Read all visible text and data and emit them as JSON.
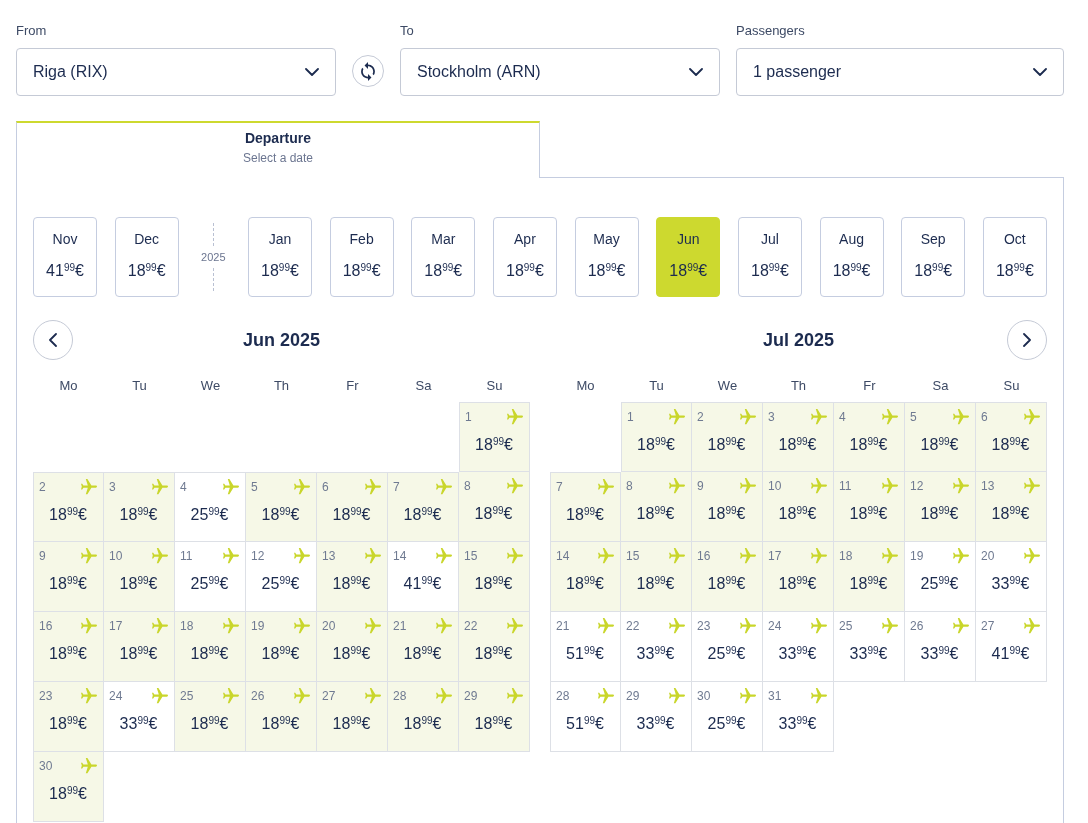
{
  "fields": [
    {
      "label": "From",
      "value": "Riga (RIX)"
    },
    {
      "label": "To",
      "value": "Stockholm (ARN)"
    },
    {
      "label": "Passengers",
      "value": "1 passenger"
    }
  ],
  "tabs": [
    {
      "title": "Departure",
      "subtitle": "Select a date",
      "selected": true
    }
  ],
  "month_strip": [
    {
      "kind": "month",
      "label": "Nov",
      "price": "41$^{99}$€",
      "selected": false
    },
    {
      "kind": "month",
      "label": "Dec",
      "price": "18$^{99}$€",
      "selected": false
    },
    {
      "kind": "year",
      "label": "2025"
    },
    {
      "kind": "month",
      "label": "Jan",
      "price": "18$^{99}$€",
      "selected": false
    },
    {
      "kind": "month",
      "label": "Feb",
      "price": "18$^{99}$€",
      "selected": false
    },
    {
      "kind": "month",
      "label": "Mar",
      "price": "18$^{99}$€",
      "selected": false
    },
    {
      "kind": "month",
      "label": "Apr",
      "price": "18$^{99}$€",
      "selected": false
    },
    {
      "kind": "month",
      "label": "May",
      "price": "18$^{99}$€",
      "selected": false
    },
    {
      "kind": "month",
      "label": "Jun",
      "price": "18$^{99}$€",
      "selected": true
    },
    {
      "kind": "month",
      "label": "Jul",
      "price": "18$^{99}$€",
      "selected": false
    },
    {
      "kind": "month",
      "label": "Aug",
      "price": "18$^{99}$€",
      "selected": false
    },
    {
      "kind": "month",
      "label": "Sep",
      "price": "18$^{99}$€",
      "selected": false
    },
    {
      "kind": "month",
      "label": "Oct",
      "price": "18$^{99}$€",
      "selected": false
    }
  ],
  "calendars": [
    {
      "title": "Jun 2025",
      "weekdays": [
        "Mo",
        "Tu",
        "We",
        "Th",
        "Fr",
        "Sa",
        "Su"
      ],
      "weeks": [
        [
          {
            "day": "1",
            "price": "18$^{99}$€",
            "low_fare": true
          }
        ],
        [
          {
            "day": "2",
            "price": "18$^{99}$€",
            "low_fare": true
          },
          {
            "day": "3",
            "price": "18$^{99}$€",
            "low_fare": true
          },
          {
            "day": "4",
            "price": "25$^{99}$€",
            "low_fare": false
          },
          {
            "day": "5",
            "price": "18$^{99}$€",
            "low_fare": true
          },
          {
            "day": "6",
            "price": "18$^{99}$€",
            "low_fare": true
          },
          {
            "day": "7",
            "price": "18$^{99}$€",
            "low_fare": true
          },
          {
            "day": "8",
            "price": "18$^{99}$€",
            "low_fare": true
          }
        ],
        [
          {
            "day": "9",
            "price": "18$^{99}$€",
            "low_fare": true
          },
          {
            "day": "10",
            "price": "18$^{99}$€",
            "low_fare": true
          },
          {
            "day": "11",
            "price": "25$^{99}$€",
            "low_fare": false
          },
          {
            "day": "12",
            "price": "25$^{99}$€",
            "low_fare": false
          },
          {
            "day": "13",
            "price": "18$^{99}$€",
            "low_fare": true
          },
          {
            "day": "14",
            "price": "41$^{99}$€",
            "low_fare": false
          },
          {
            "day": "15",
            "price": "18$^{99}$€",
            "low_fare": true
          }
        ],
        [
          {
            "day": "16",
            "price": "18$^{99}$€",
            "low_fare": true
          },
          {
            "day": "17",
            "price": "18$^{99}$€",
            "low_fare": true
          },
          {
            "day": "18",
            "price": "18$^{99}$€",
            "low_fare": true
          },
          {
            "day": "19",
            "price": "18$^{99}$€",
            "low_fare": true
          },
          {
            "day": "20",
            "price": "18$^{99}$€",
            "low_fare": true
          },
          {
            "day": "21",
            "price": "18$^{99}$€",
            "low_fare": true
          },
          {
            "day": "22",
            "price": "18$^{99}$€",
            "low_fare": true
          }
        ],
        [
          {
            "day": "23",
            "price": "18$^{99}$€",
            "low_fare": true
          },
          {
            "day": "24",
            "price": "33$^{99}$€",
            "low_fare": false
          },
          {
            "day": "25",
            "price": "18$^{99}$€",
            "low_fare": true
          },
          {
            "day": "26",
            "price": "18$^{99}$€",
            "low_fare": true
          },
          {
            "day": "27",
            "price": "18$^{99}$€",
            "low_fare": true
          },
          {
            "day": "28",
            "price": "18$^{99}$€",
            "low_fare": true
          },
          {
            "day": "29",
            "price": "18$^{99}$€",
            "low_fare": true
          }
        ],
        [
          {
            "day": "30",
            "price": "18$^{99}$€",
            "low_fare": true
          }
        ]
      ]
    },
    {
      "title": "Jul 2025",
      "weekdays": [
        "Mo",
        "Tu",
        "We",
        "Th",
        "Fr",
        "Sa",
        "Su"
      ],
      "weeks": [
        [
          {
            "day": "1",
            "price": "18$^{99}$€",
            "low_fare": true
          },
          {
            "day": "2",
            "price": "18$^{99}$€",
            "low_fare": true
          },
          {
            "day": "3",
            "price": "18$^{99}$€",
            "low_fare": true
          },
          {
            "day": "4",
            "price": "18$^{99}$€",
            "low_fare": true
          },
          {
            "day": "5",
            "price": "18$^{99}$€",
            "low_fare": true
          },
          {
            "day": "6",
            "price": "18$^{99}$€",
            "low_fare": true
          }
        ],
        [
          {
            "day": "7",
            "price": "18$^{99}$€",
            "low_fare": true
          },
          {
            "day": "8",
            "price": "18$^{99}$€",
            "low_fare": true
          },
          {
            "day": "9",
            "price": "18$^{99}$€",
            "low_fare": true
          },
          {
            "day": "10",
            "price": "18$^{99}$€",
            "low_fare": true
          },
          {
            "day": "11",
            "price": "18$^{99}$€",
            "low_fare": true
          },
          {
            "day": "12",
            "price": "18$^{99}$€",
            "low_fare": true
          },
          {
            "day": "13",
            "price": "18$^{99}$€",
            "low_fare": true
          }
        ],
        [
          {
            "day": "14",
            "price": "18$^{99}$€",
            "low_fare": true
          },
          {
            "day": "15",
            "price": "18$^{99}$€",
            "low_fare": true
          },
          {
            "day": "16",
            "price": "18$^{99}$€",
            "low_fare": true
          },
          {
            "day": "17",
            "price": "18$^{99}$€",
            "low_fare": true
          },
          {
            "day": "18",
            "price": "18$^{99}$€",
            "low_fare": true
          },
          {
            "day": "19",
            "price": "25$^{99}$€",
            "low_fare": false
          },
          {
            "day": "20",
            "price": "33$^{99}$€",
            "low_fare": false
          }
        ],
        [
          {
            "day": "21",
            "price": "51$^{99}$€",
            "low_fare": false
          },
          {
            "day": "22",
            "price": "33$^{99}$€",
            "low_fare": false
          },
          {
            "day": "23",
            "price": "25$^{99}$€",
            "low_fare": false
          },
          {
            "day": "24",
            "price": "33$^{99}$€",
            "low_fare": false
          },
          {
            "day": "25",
            "price": "33$^{99}$€",
            "low_fare": false
          },
          {
            "day": "26",
            "price": "33$^{99}$€",
            "low_fare": false
          },
          {
            "day": "27",
            "price": "41$^{99}$€",
            "low_fare": false
          }
        ],
        [
          {
            "day": "28",
            "price": "51$^{99}$€",
            "low_fare": false
          },
          {
            "day": "29",
            "price": "33$^{99}$€",
            "low_fare": false
          },
          {
            "day": "30",
            "price": "25$^{99}$€",
            "low_fare": false
          },
          {
            "day": "31",
            "price": "33$^{99}$€",
            "low_fare": false
          }
        ]
      ]
    }
  ]
}
